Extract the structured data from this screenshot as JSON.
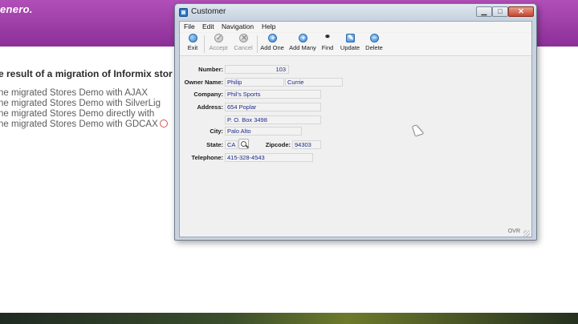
{
  "web": {
    "brand": "enero.",
    "heading": "e result of a migration of Informix stor",
    "links": [
      "ne migrated Stores Demo with AJAX",
      "ne migrated Stores Demo with SilverLig",
      "ne migrated Stores Demo directly with",
      "ne migrated Stores Demo with GDCAX"
    ]
  },
  "window": {
    "title": "Customer",
    "controls": {
      "minimize": "▁",
      "maximize": "□",
      "close": "✕"
    }
  },
  "menu": [
    "File",
    "Edit",
    "Navigation",
    "Help"
  ],
  "toolbar": [
    {
      "label": "Exit",
      "icon": "exit-icon",
      "enabled": true
    },
    {
      "label": "Accept",
      "icon": "accept-icon",
      "enabled": false
    },
    {
      "label": "Cancel",
      "icon": "cancel-icon",
      "enabled": false
    },
    {
      "label": "Add One",
      "icon": "add-one-icon",
      "enabled": true
    },
    {
      "label": "Add Many",
      "icon": "add-many-icon",
      "enabled": true
    },
    {
      "label": "Find",
      "icon": "binoculars-icon",
      "enabled": true
    },
    {
      "label": "Update",
      "icon": "update-icon",
      "enabled": true
    },
    {
      "label": "Delete",
      "icon": "delete-icon",
      "enabled": true
    }
  ],
  "form": {
    "number_label": "Number:",
    "number": "103",
    "owner_label": "Owner Name:",
    "first_name": "Philip",
    "last_name": "Currie",
    "company_label": "Company:",
    "company": "Phil's Sports",
    "address_label": "Address:",
    "address1": "654 Poplar",
    "address2": "P. O. Box 3498",
    "city_label": "City:",
    "city": "Palo Alto",
    "state_label": "State:",
    "state": "CA",
    "zipcode_label": "Zipcode:",
    "zipcode": "94303",
    "telephone_label": "Telephone:",
    "telephone": "415-328-4543"
  },
  "status": {
    "mode": "OVR"
  },
  "colors": {
    "header_purple": "#9b3fa6",
    "field_text": "#1d2a8a",
    "close_red": "#c8462f"
  }
}
